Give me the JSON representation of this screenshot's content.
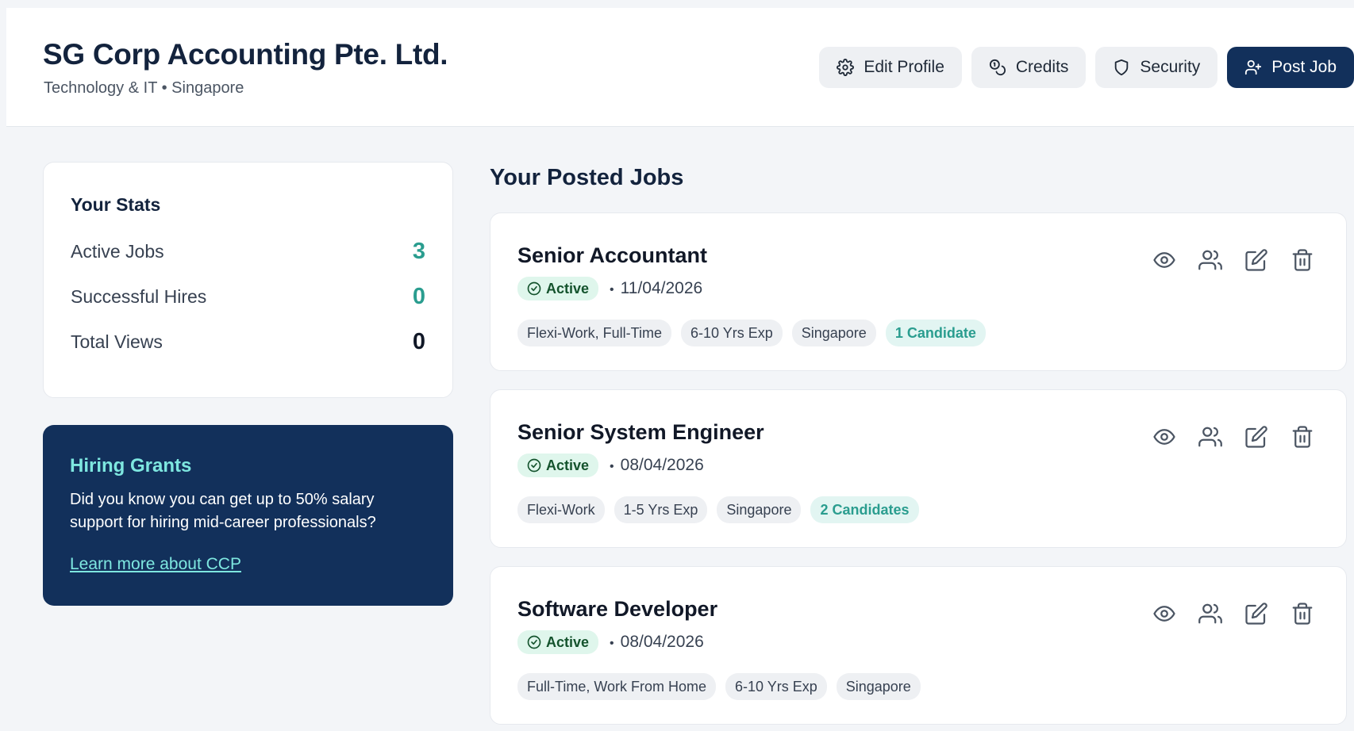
{
  "header": {
    "company_name": "SG Corp Accounting Pte. Ltd.",
    "subtitle": "Technology & IT • Singapore",
    "actions": {
      "edit_profile": "Edit Profile",
      "credits": "Credits",
      "security": "Security",
      "post_job": "Post Job"
    }
  },
  "stats": {
    "title": "Your Stats",
    "items": [
      {
        "label": "Active Jobs",
        "value": "3"
      },
      {
        "label": "Successful Hires",
        "value": "0"
      },
      {
        "label": "Total Views",
        "value": "0"
      }
    ]
  },
  "grants": {
    "title": "Hiring Grants",
    "text": "Did you know you can get up to 50% salary support for hiring mid-career professionals?",
    "link": "Learn more about CCP"
  },
  "jobs": {
    "title": "Your Posted Jobs",
    "items": [
      {
        "title": "Senior Accountant",
        "status": "Active",
        "date": "11/04/2026",
        "tags": [
          "Flexi-Work, Full-Time",
          "6-10 Yrs Exp",
          "Singapore"
        ],
        "candidates": "1 Candidate"
      },
      {
        "title": "Senior System Engineer",
        "status": "Active",
        "date": "08/04/2026",
        "tags": [
          "Flexi-Work",
          "1-5 Yrs Exp",
          "Singapore"
        ],
        "candidates": "2 Candidates"
      },
      {
        "title": "Software Developer",
        "status": "Active",
        "date": "08/04/2026",
        "tags": [
          "Full-Time, Work From Home",
          "6-10 Yrs Exp",
          "Singapore"
        ],
        "candidates": null
      }
    ]
  },
  "colors": {
    "navy": "#12305b",
    "teal": "#2a9d8f",
    "accent_light": "#7ee7e0",
    "active_badge_bg": "#dff6ec"
  },
  "icons": [
    "gear-icon",
    "coins-icon",
    "shield-icon",
    "user-plus-icon",
    "eye-icon",
    "users-icon",
    "edit-icon",
    "trash-icon",
    "check-circle-icon"
  ]
}
